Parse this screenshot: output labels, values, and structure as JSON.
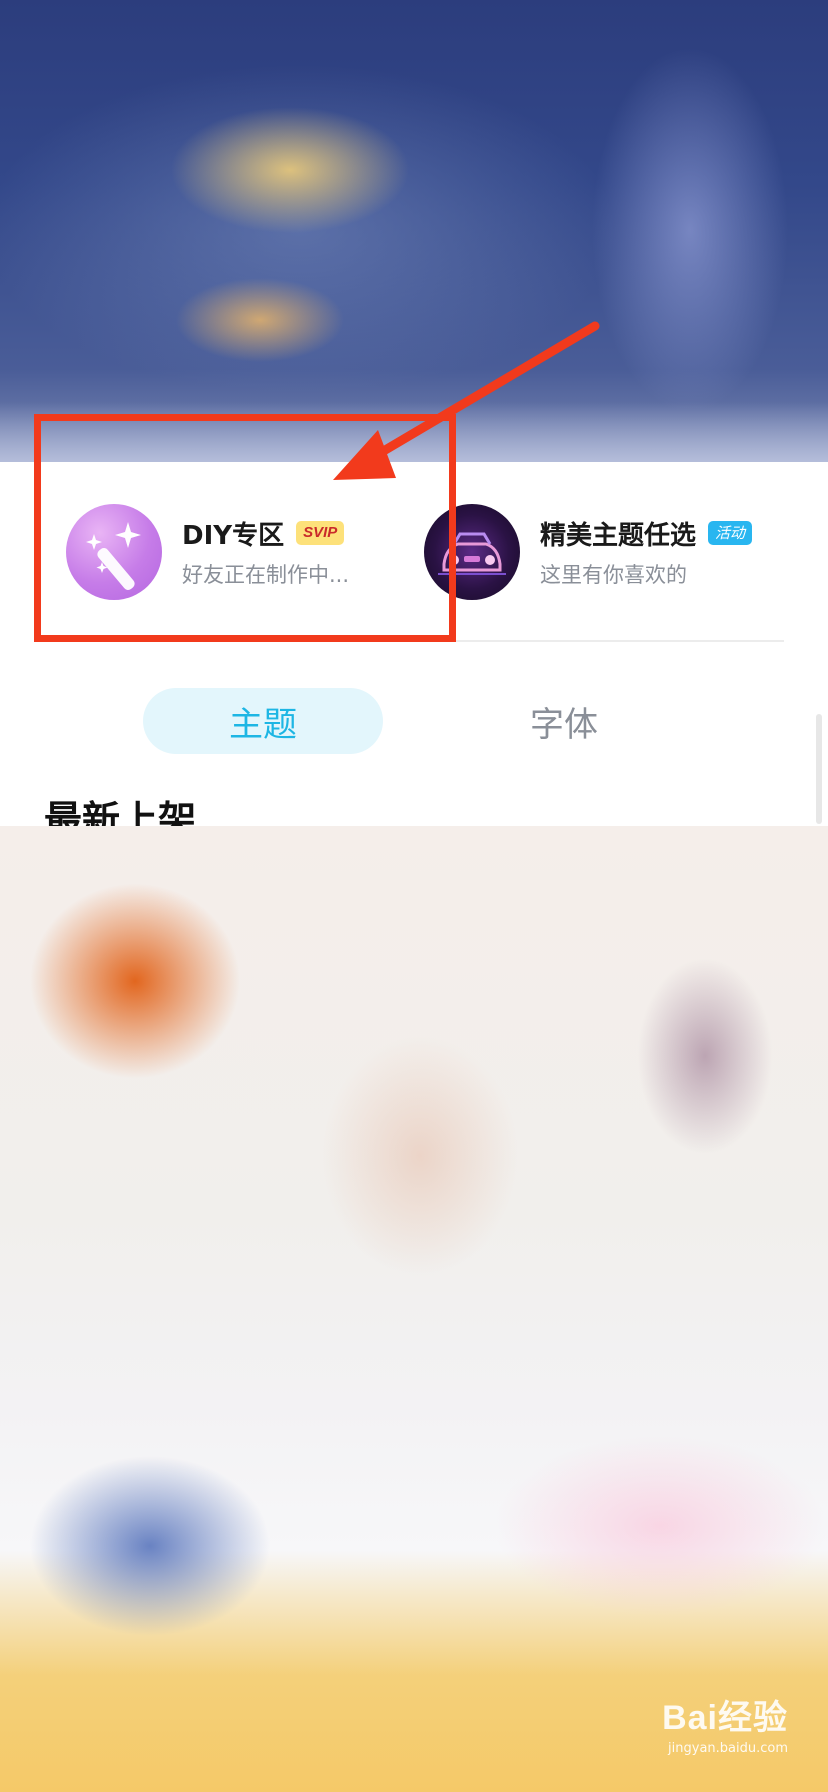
{
  "entries": {
    "diy": {
      "title": "DIY专区",
      "badge": "SVIP",
      "subtitle": "好友正在制作中..."
    },
    "theme_pick": {
      "title": "精美主题任选",
      "badge": "活动",
      "subtitle": "这里有你喜欢的"
    }
  },
  "tabs": [
    {
      "label": "主题",
      "selected": true
    },
    {
      "label": "字体",
      "selected": false
    }
  ],
  "section": {
    "title": "最新上架"
  },
  "watermark": {
    "logo": "Bai经验",
    "url": "jingyan.baidu.com"
  },
  "colors": {
    "annotation": "#f23a1c",
    "accent": "#1db6e4",
    "svip_badge": "#fde17a",
    "event_badge": "#29b6f0"
  },
  "icons": {
    "diy": "magic-wand-sparkles-icon",
    "theme_pick": "neon-car-icon"
  }
}
